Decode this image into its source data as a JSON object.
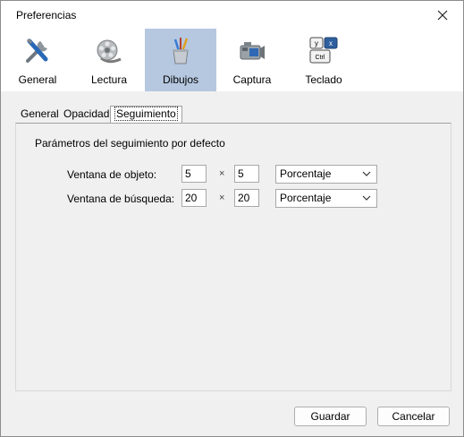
{
  "window": {
    "title": "Preferencias"
  },
  "toolbar": {
    "items": [
      {
        "label": "General",
        "icon": "tools-icon"
      },
      {
        "label": "Lectura",
        "icon": "film-reel-icon"
      },
      {
        "label": "Dibujos",
        "icon": "brush-cup-icon",
        "selected": true
      },
      {
        "label": "Captura",
        "icon": "camera-icon"
      },
      {
        "label": "Teclado",
        "icon": "keyboard-icon"
      }
    ],
    "keycaps": {
      "y": "y",
      "x": "x",
      "ctrl": "Ctrl"
    }
  },
  "tabs": [
    {
      "label": "General"
    },
    {
      "label": "Opacidad"
    },
    {
      "label": "Seguimiento",
      "active": true
    }
  ],
  "panel": {
    "section_title": "Parámetros del seguimiento por defecto",
    "rows": [
      {
        "label": "Ventana de objeto:",
        "width": "5",
        "sep": "×",
        "height": "5",
        "unit": "Porcentaje"
      },
      {
        "label": "Ventana de búsqueda:",
        "width": "20",
        "sep": "×",
        "height": "20",
        "unit": "Porcentaje"
      }
    ]
  },
  "buttons": {
    "save": "Guardar",
    "cancel": "Cancelar"
  },
  "colors": {
    "selected_tool_bg": "#b6c8e0",
    "window_bg": "#f0f0f0"
  }
}
